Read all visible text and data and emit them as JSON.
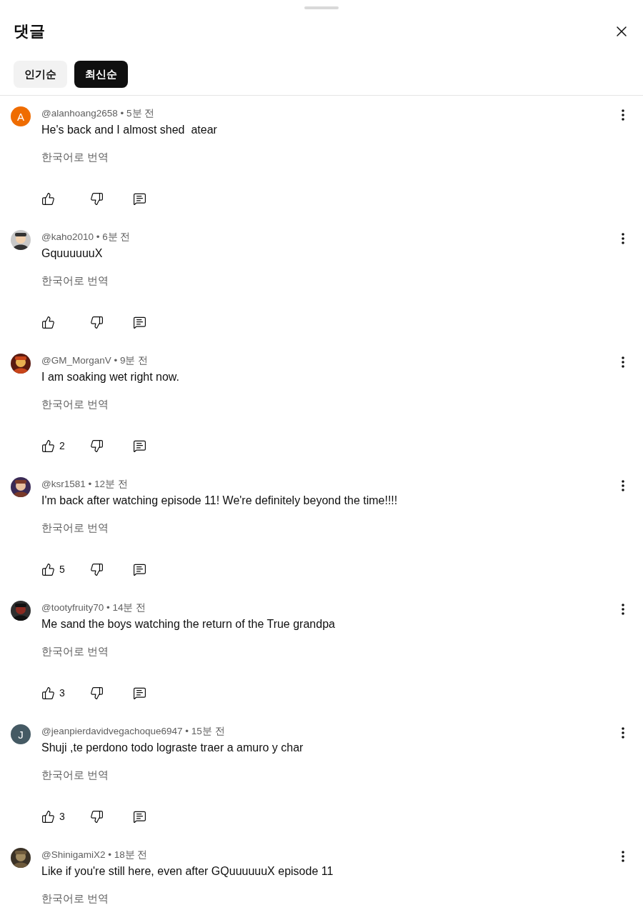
{
  "sheet": {
    "title": "댓글"
  },
  "tabs": [
    {
      "label": "인기순",
      "selected": false
    },
    {
      "label": "최신순",
      "selected": true
    }
  ],
  "comments": [
    {
      "avatar": {
        "kind": "letter",
        "letter": "A",
        "color": "#ef6c00"
      },
      "meta": "@alanhoang2658 • 5분 전",
      "text": "He's back and I almost shed  atear",
      "translate": "한국어로 번역",
      "actions": [
        {
          "kind": "like"
        },
        {
          "kind": "dislike"
        },
        {
          "kind": "reply"
        }
      ]
    },
    {
      "meta": "@kaho2010 • 6분 전",
      "text": "GquuuuuuX",
      "translate": "한국어로 번역",
      "actions": [
        {
          "kind": "like"
        },
        {
          "kind": "dislike"
        },
        {
          "kind": "reply"
        }
      ]
    },
    {
      "meta": "@GM_MorganV • 9분 전",
      "text": "I am soaking wet right now.",
      "translate": "한국어로 번역",
      "actions": [
        {
          "kind": "like",
          "count": "2"
        },
        {
          "kind": "dislike"
        },
        {
          "kind": "reply"
        }
      ]
    },
    {
      "meta": "@ksr1581 • 12분 전",
      "text": "I'm back after watching episode 11! We're definitely beyond the time!!!!",
      "translate": "한국어로 번역",
      "actions": [
        {
          "kind": "like",
          "count": "5"
        },
        {
          "kind": "dislike"
        },
        {
          "kind": "reply"
        }
      ]
    },
    {
      "meta": "@tootyfruity70 • 14분 전",
      "text": "Me sand the boys watching the return of the True grandpa",
      "translate": "한국어로 번역",
      "actions": [
        {
          "kind": "like",
          "count": "3"
        },
        {
          "kind": "dislike"
        },
        {
          "kind": "reply"
        }
      ]
    },
    {
      "avatar": {
        "kind": "letter",
        "letter": "J",
        "color": "#455a64"
      },
      "meta": "@jeanpierdavidvegachoque6947 • 15분 전",
      "text": "Shuji ,te perdono todo lograste traer a amuro y char",
      "translate": "한국어로 번역",
      "actions": [
        {
          "kind": "like",
          "count": "3"
        },
        {
          "kind": "dislike"
        },
        {
          "kind": "reply"
        }
      ]
    },
    {
      "meta": "@ShinigamiX2 • 18분 전",
      "text": "Like if you're still here, even after GQuuuuuuX episode 11",
      "translate": "한국어로 번역"
    }
  ]
}
